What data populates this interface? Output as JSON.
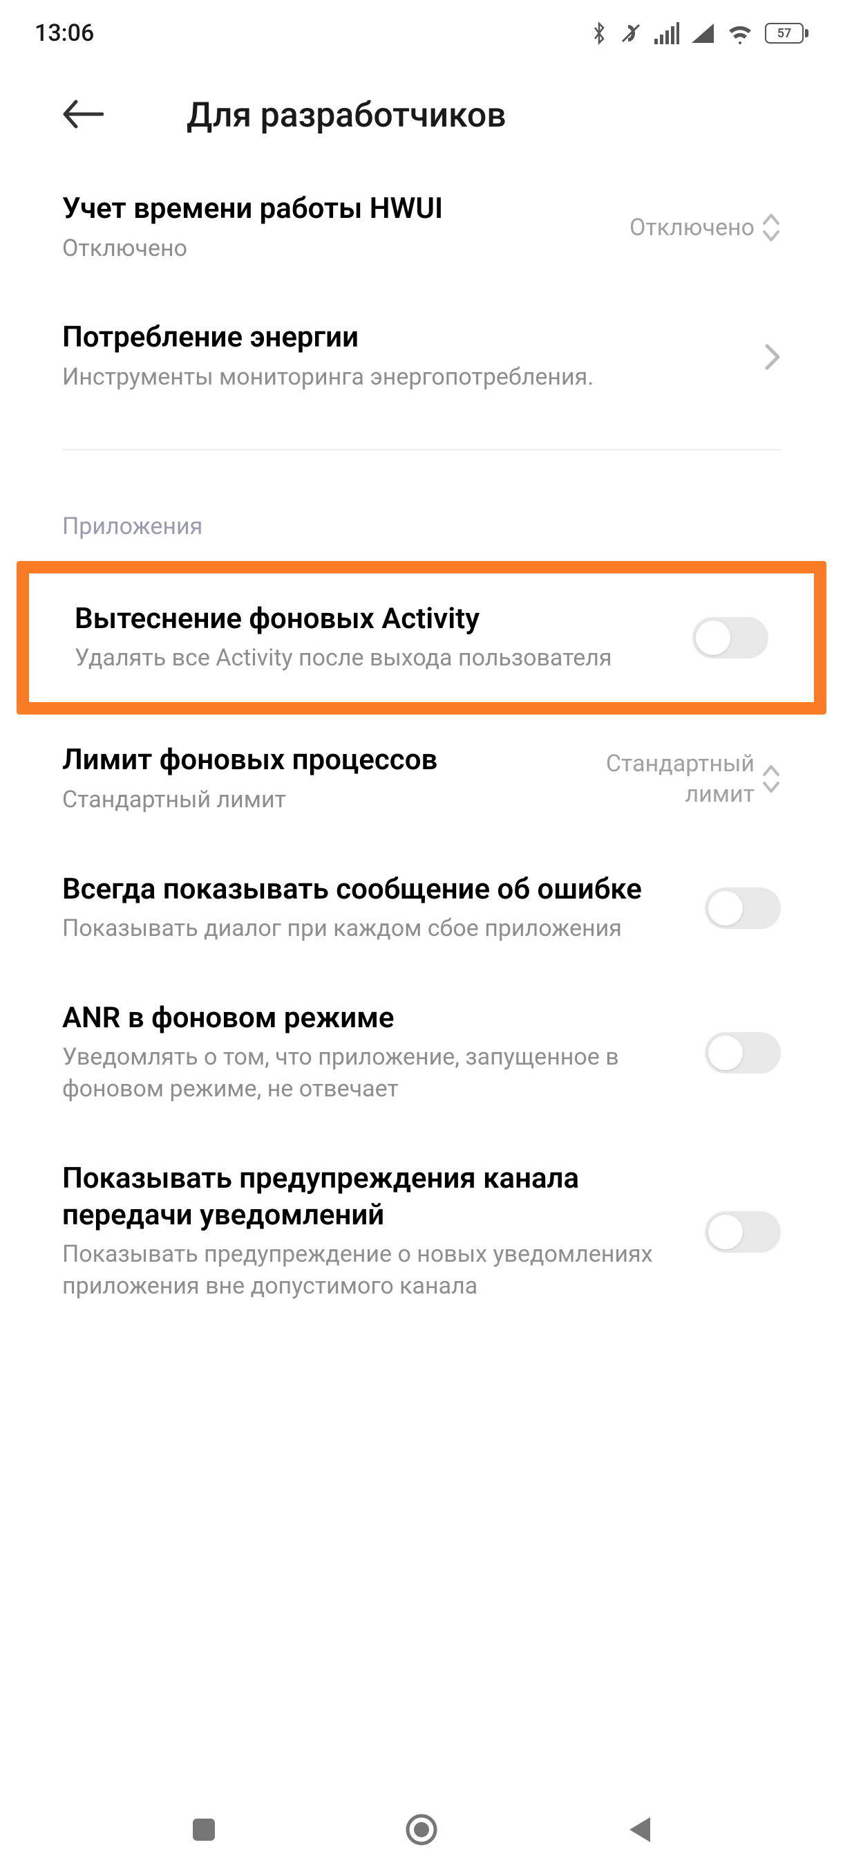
{
  "status_bar": {
    "time": "13:06",
    "battery_pct": "57"
  },
  "header": {
    "title": "Для разработчиков"
  },
  "rows": {
    "hwui": {
      "title": "Учет времени работы HWUI",
      "sub": "Отключено",
      "value": "Отключено"
    },
    "energy": {
      "title": "Потребление энергии",
      "sub": "Инструменты мониторинга энергопотребления."
    }
  },
  "section_apps": "Приложения",
  "apps": {
    "evict": {
      "title": "Вытеснение фоновых Activity",
      "sub": "Удалять все Activity после выхода пользователя"
    },
    "bg_limit": {
      "title": "Лимит фоновых процессов",
      "sub": "Стандартный лимит",
      "value": "Стандартный лимит"
    },
    "show_crash": {
      "title": "Всегда показывать сообщение об ошибке",
      "sub": "Показывать диалог при каждом сбое приложения"
    },
    "anr_bg": {
      "title": "ANR в фоновом режиме",
      "sub": "Уведомлять о том, что приложение, запущенное в фоновом режиме, не отвечает"
    },
    "notif_channel": {
      "title": "Показывать предупреждения канала передачи уведомлений",
      "sub": "Показывать предупреждение о новых уведомлениях приложения вне допустимого канала"
    }
  }
}
